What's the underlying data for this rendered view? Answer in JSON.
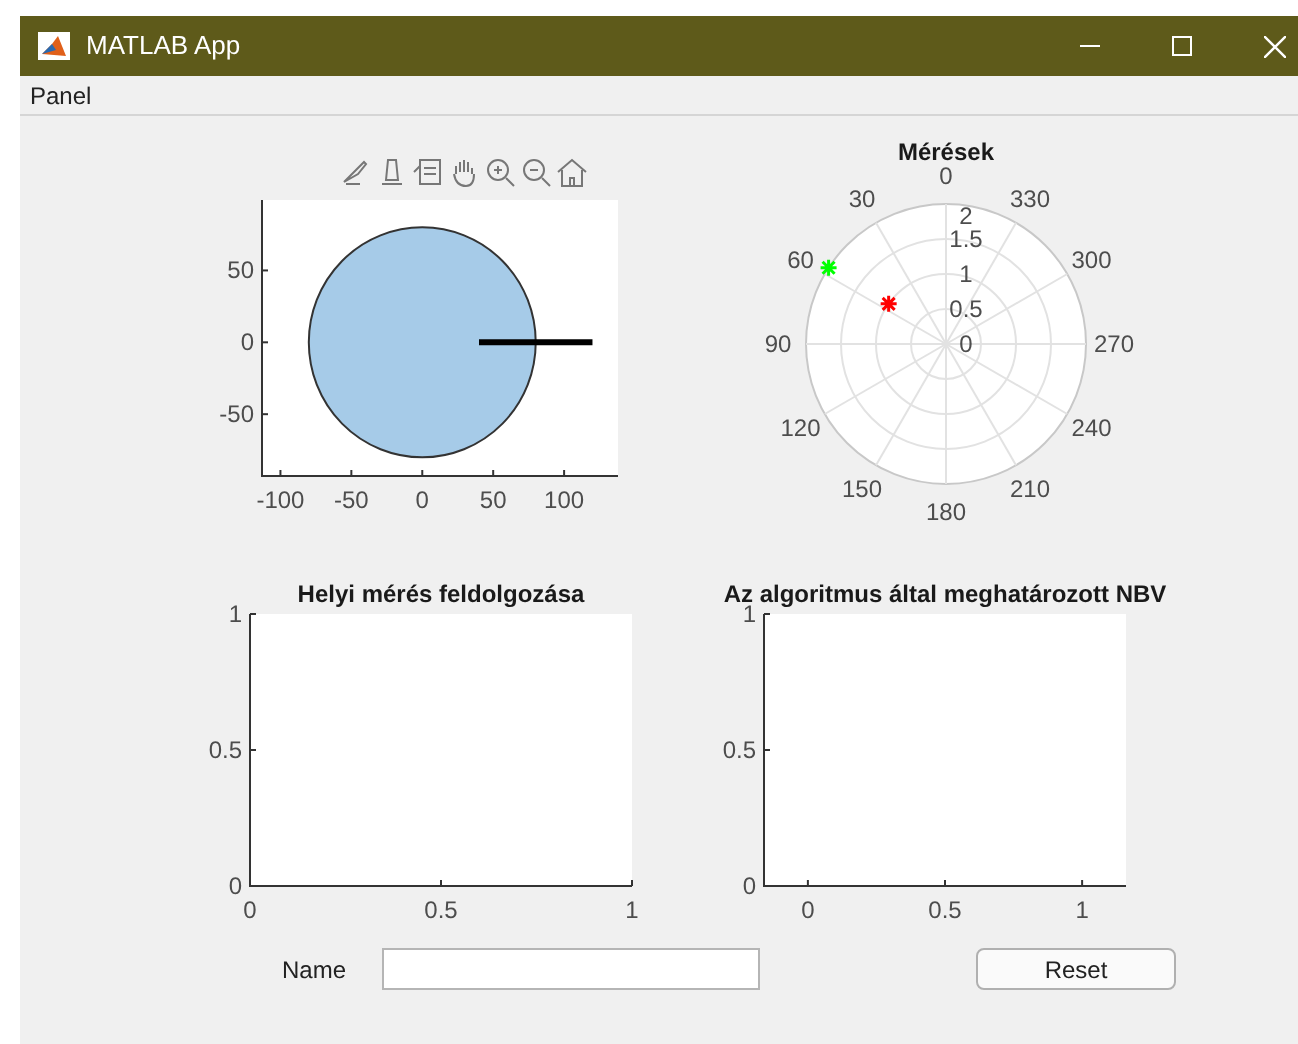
{
  "window": {
    "title": "MATLAB App"
  },
  "menu": [
    {
      "label": "Panel"
    }
  ],
  "plots": [
    {
      "kind": "cartesian",
      "chart_data": {
        "type": "line",
        "xlim": [
          -113,
          138
        ],
        "ylim": [
          -93,
          99
        ],
        "xticks": [
          -100,
          -50,
          0,
          50,
          100
        ],
        "yticks": [
          -50,
          0,
          50
        ],
        "series": [
          {
            "color": "#000000",
            "x": [
              40,
              120
            ],
            "values": [
              0,
              0
            ]
          }
        ]
      }
    },
    {
      "kind": "polar",
      "title": "Mérések",
      "angle_labels": [
        "0",
        "30",
        "60",
        "90",
        "120",
        "150",
        "180",
        "210",
        "240",
        "270",
        "300",
        "330"
      ],
      "radius_labels": [
        "2",
        "1.5",
        "1",
        "0.5",
        "0"
      ],
      "points": [
        {
          "color": "#00ff00"
        },
        {
          "color": "#ff0000"
        }
      ]
    },
    {
      "kind": "cartesian",
      "chart_data": {
        "type": "line",
        "title": "Helyi mérés feldolgozása",
        "xlim": [
          0,
          1
        ],
        "ylim": [
          0,
          1
        ],
        "xticks": [
          0,
          0.5,
          1
        ],
        "yticks": [
          0,
          0.5,
          1
        ]
      }
    },
    {
      "kind": "cartesian",
      "chart_data": {
        "type": "line",
        "title": "Az algoritmus által meghatározott NBV",
        "xlim": [
          -0.16,
          1.16
        ],
        "ylim": [
          0,
          1
        ],
        "xticks": [
          0,
          0.5,
          1
        ],
        "yticks": [
          0,
          0.5,
          1
        ]
      }
    }
  ],
  "form": {
    "name_label": "Name",
    "reset_button": "Reset"
  }
}
